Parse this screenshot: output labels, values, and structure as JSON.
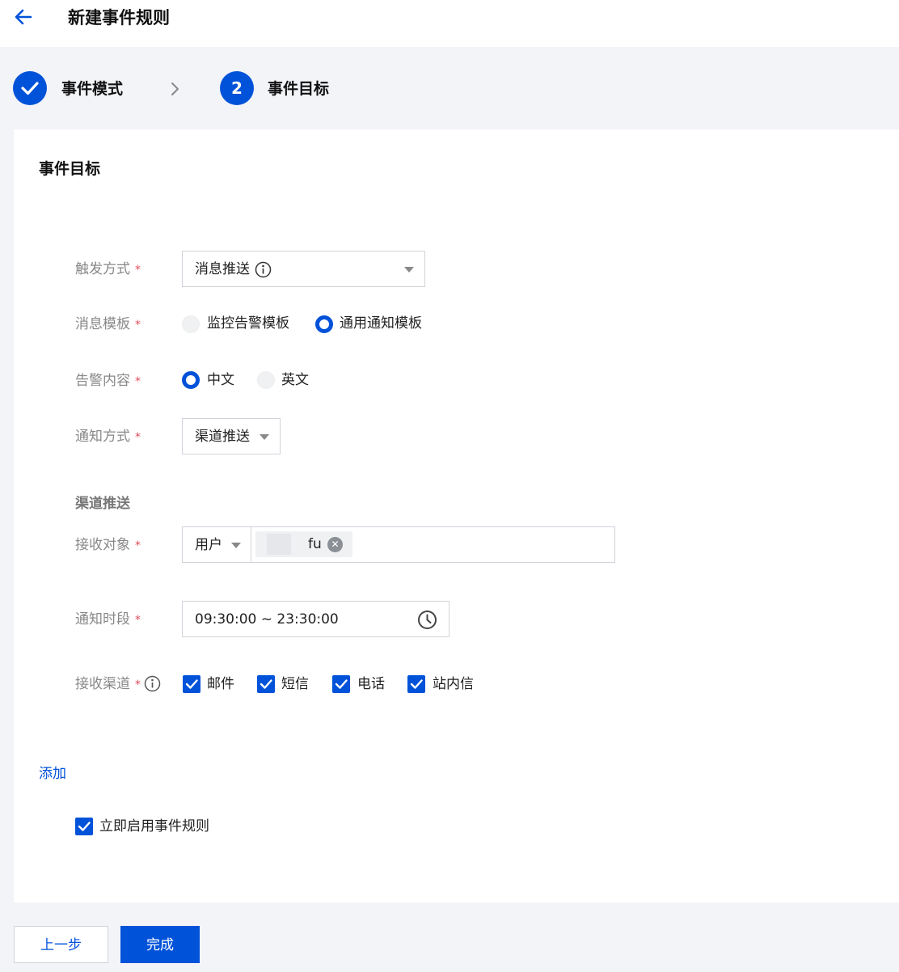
{
  "header": {
    "title": "新建事件规则",
    "back_icon": "arrow-left-icon"
  },
  "steps": [
    {
      "label": "事件模式",
      "status": "done"
    },
    {
      "label": "事件目标",
      "number": "2",
      "status": "active"
    }
  ],
  "section": {
    "title": "事件目标"
  },
  "form": {
    "trigger": {
      "label": "触发方式",
      "required_mark": "*",
      "value": "消息推送"
    },
    "template": {
      "label": "消息模板",
      "required_mark": "*",
      "options": [
        "监控告警模板",
        "通用通知模板"
      ],
      "selected": "通用通知模板"
    },
    "content": {
      "label": "告警内容",
      "required_mark": "*",
      "options": [
        "中文",
        "英文"
      ],
      "selected": "中文"
    },
    "notify_method": {
      "label": "通知方式",
      "required_mark": "*",
      "value": "渠道推送"
    },
    "channel_section_title": "渠道推送",
    "receiver": {
      "label": "接收对象",
      "required_mark": "*",
      "type_value": "用户",
      "tag_text": "fu"
    },
    "time_range": {
      "label": "通知时段",
      "required_mark": "*",
      "value": "09:30:00 ~ 23:30:00"
    },
    "channels": {
      "label": "接收渠道",
      "required_mark": "*",
      "items": [
        "邮件",
        "短信",
        "电话",
        "站内信"
      ]
    }
  },
  "add_link": "添加",
  "enable_rule": {
    "label": "立即启用事件规则",
    "checked": true
  },
  "buttons": {
    "prev": "上一步",
    "done": "完成"
  },
  "colors": {
    "primary": "#0052d9",
    "required": "#e34d59",
    "background": "#f2f4f8"
  }
}
